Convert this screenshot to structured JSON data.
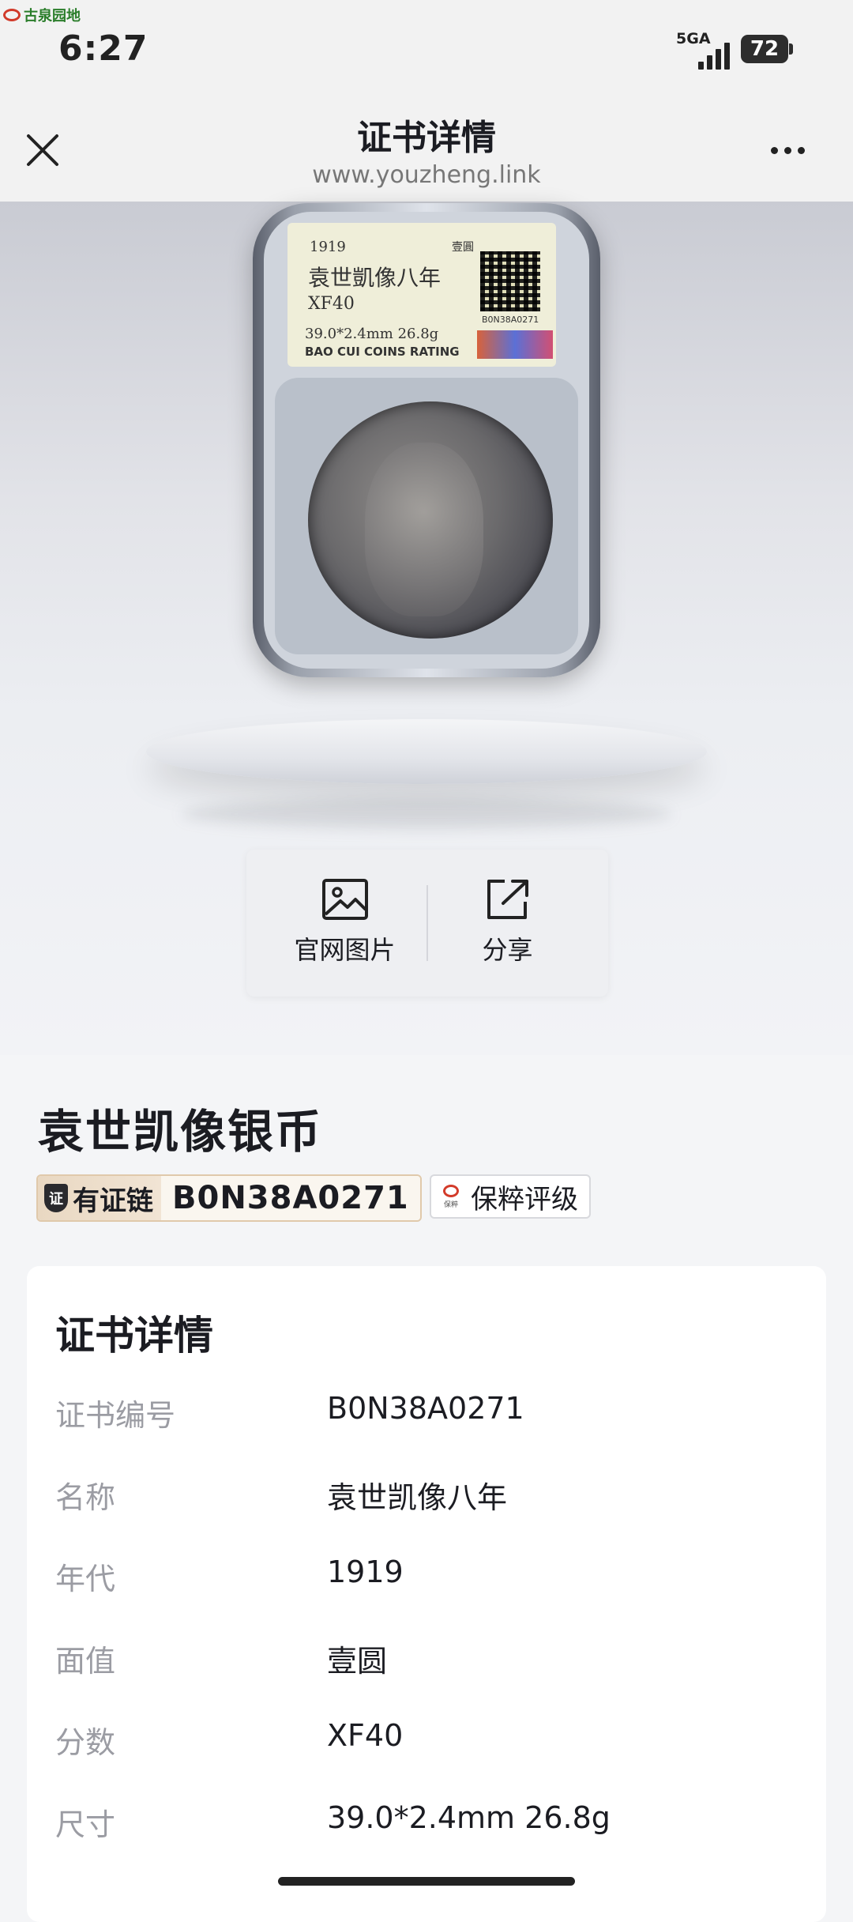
{
  "status_bar": {
    "watermark": "古泉园地",
    "time": "6:27",
    "network": "5GA",
    "battery": "72"
  },
  "header": {
    "title": "证书详情",
    "url": "www.youzheng.link"
  },
  "slab_label": {
    "year": "1919",
    "seal": "壹圓",
    "name": "袁世凱像八年",
    "grade": "XF40",
    "size_weight": "39.0*2.4mm  26.8g",
    "company": "BAO CUI COINS RATING",
    "serial": "B0N38A0271"
  },
  "actions": [
    {
      "label": "官网图片",
      "icon": "image-icon"
    },
    {
      "label": "分享",
      "icon": "share-icon"
    }
  ],
  "coin": {
    "title": "袁世凯像银币",
    "chain_label": "有证链",
    "chain_shield": "证",
    "cert_no": "B0N38A0271",
    "grader": "保粹评级",
    "grader_logo_text": "保粹"
  },
  "details": {
    "title": "证书详情",
    "rows": [
      {
        "label": "证书编号",
        "value": "B0N38A0271"
      },
      {
        "label": "名称",
        "value": "袁世凯像八年"
      },
      {
        "label": "年代",
        "value": "1919"
      },
      {
        "label": "面值",
        "value": "壹圆"
      },
      {
        "label": "分数",
        "value": "XF40"
      },
      {
        "label": "尺寸",
        "value": "39.0*2.4mm 26.8g"
      }
    ]
  }
}
